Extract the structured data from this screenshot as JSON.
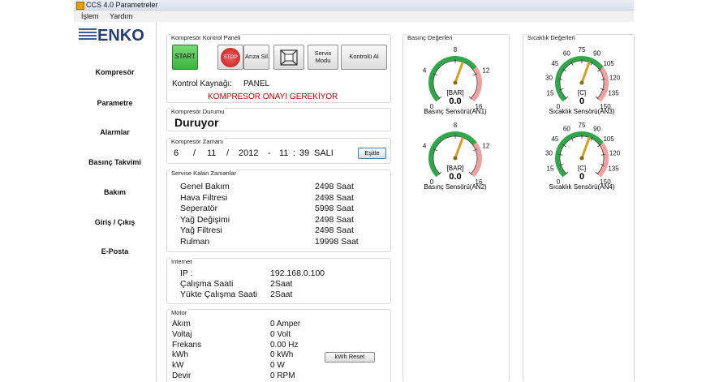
{
  "window": {
    "title": "CCS 4.0 Parametreler"
  },
  "menu": {
    "items": [
      "İşlem",
      "Yardım"
    ]
  },
  "logo": {
    "text": "ENKO"
  },
  "sidebar": {
    "items": [
      "Kompresör",
      "Parametre",
      "Alarmlar",
      "Basınç Takvimi",
      "Bakım",
      "Giriş / Çıkış",
      "E-Posta"
    ]
  },
  "control_panel": {
    "title": "Kompresör Kontrol Paneli",
    "buttons": {
      "start": "START",
      "stop": "STOP",
      "fault_reset": "Arıza Sil",
      "service_mode": "Servis Modu",
      "take_control": "Kontrolü Al"
    },
    "source_label": "Kontrol Kaynağı:",
    "source_value": "PANEL",
    "warning": "KOMPRESÖR ONAYI GEREKİYOR",
    "warning_color": "#d40000"
  },
  "status": {
    "title": "Kompresör Durumu",
    "value": "Duruyor"
  },
  "time": {
    "title": "Kompresör Zamanı",
    "day": "6",
    "sep1": "/",
    "month": "11",
    "sep2": "/",
    "year": "2012",
    "dash": "-",
    "hour": "11",
    "colon": ":",
    "minute": "39",
    "weekday": "SALI",
    "sync_button": "Eşitle"
  },
  "service_times": {
    "title": "Servise Kalan Zamanlar",
    "rows": [
      {
        "name": "Genel Bakım",
        "value": "2498 Saat"
      },
      {
        "name": "Hava Filtresi",
        "value": "2498 Saat"
      },
      {
        "name": "Seperatör",
        "value": "5998 Saat"
      },
      {
        "name": "Yağ Değişimi",
        "value": "2498 Saat"
      },
      {
        "name": "Yağ Filtresi",
        "value": "2498 Saat"
      },
      {
        "name": "Rulman",
        "value": "19998 Saat"
      }
    ]
  },
  "internet": {
    "title": "Internet",
    "rows": [
      {
        "name": "IP :",
        "value": "192.168.0.100"
      },
      {
        "name": "Çalışma Saati",
        "value": "2Saat"
      },
      {
        "name": "Yükte Çalışma Saati",
        "value": "2Saat"
      }
    ]
  },
  "motor": {
    "title": "Motor",
    "rows": [
      {
        "name": "Akım",
        "value": "0 Amper"
      },
      {
        "name": "Voltaj",
        "value": "0 Volt"
      },
      {
        "name": "Frekans",
        "value": "0.00 Hz"
      },
      {
        "name": "kWh",
        "value": "0 kWh"
      },
      {
        "name": "kW",
        "value": "0 W"
      },
      {
        "name": "Devir",
        "value": "0 RPM"
      }
    ],
    "reset_button": "kWh Reset"
  },
  "pressure": {
    "title": "Basınç Değerleri",
    "gauges": [
      {
        "unit": "[BAR]",
        "value": "0.0",
        "label": "Basınç Sensörü(AN1)",
        "ticks": [
          "0",
          "4",
          "8",
          "12",
          "16"
        ]
      },
      {
        "unit": "[BAR]",
        "value": "0.0",
        "label": "Basınç Sensörü(AN2)",
        "ticks": [
          "0",
          "4",
          "8",
          "12",
          "16"
        ]
      }
    ]
  },
  "temperature": {
    "title": "Sıcaklık Değerleri",
    "gauges": [
      {
        "unit": "[C]",
        "value": "0",
        "label": "Sıcaklık Sensörü(AN3)",
        "ticks": [
          "0",
          "15",
          "30",
          "45",
          "60",
          "75",
          "90",
          "105",
          "120",
          "135",
          "150"
        ]
      },
      {
        "unit": "[C]",
        "value": "0",
        "label": "Sıcaklık Sensörü(AN4)",
        "ticks": [
          "0",
          "15",
          "30",
          "45",
          "60",
          "75",
          "90",
          "105",
          "120",
          "135",
          "150"
        ]
      }
    ]
  },
  "colors": {
    "start_green": "#4fc24f",
    "stop_red": "#e03030",
    "gauge_green": "#2fa84a",
    "gauge_red": "#f0a0a0",
    "needle": "#d8a020"
  }
}
